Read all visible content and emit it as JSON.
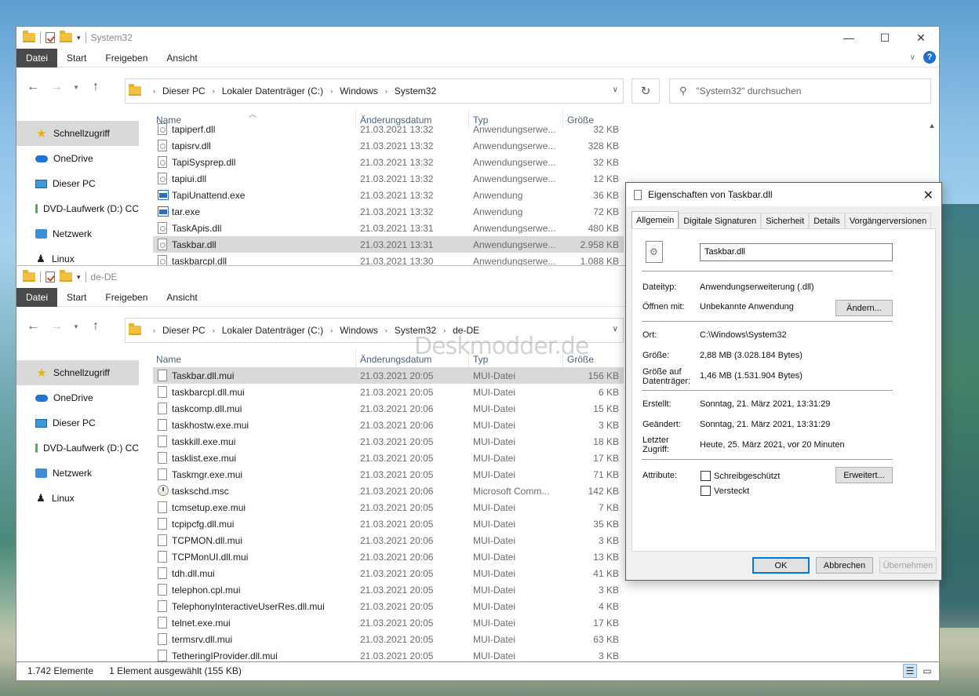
{
  "top_window": {
    "title": "System32",
    "ribbon_tabs": [
      "Datei",
      "Start",
      "Freigeben",
      "Ansicht"
    ],
    "breadcrumb": [
      "Dieser PC",
      "Lokaler Datenträger (C:)",
      "Windows",
      "System32"
    ],
    "search_placeholder": "\"System32\" durchsuchen",
    "columns": {
      "name": "Name",
      "date": "Änderungsdatum",
      "type": "Typ",
      "size": "Größe"
    },
    "files": [
      {
        "name": "tapiperf.dll",
        "date": "21.03.2021 13:32",
        "type": "Anwendungserwe...",
        "size": "32 KB",
        "icon": "dll"
      },
      {
        "name": "tapisrv.dll",
        "date": "21.03.2021 13:32",
        "type": "Anwendungserwe...",
        "size": "328 KB",
        "icon": "dll"
      },
      {
        "name": "TapiSysprep.dll",
        "date": "21.03.2021 13:32",
        "type": "Anwendungserwe...",
        "size": "32 KB",
        "icon": "dll"
      },
      {
        "name": "tapiui.dll",
        "date": "21.03.2021 13:32",
        "type": "Anwendungserwe...",
        "size": "12 KB",
        "icon": "dll"
      },
      {
        "name": "TapiUnattend.exe",
        "date": "21.03.2021 13:32",
        "type": "Anwendung",
        "size": "36 KB",
        "icon": "exe"
      },
      {
        "name": "tar.exe",
        "date": "21.03.2021 13:32",
        "type": "Anwendung",
        "size": "72 KB",
        "icon": "exe"
      },
      {
        "name": "TaskApis.dll",
        "date": "21.03.2021 13:31",
        "type": "Anwendungserwe...",
        "size": "480 KB",
        "icon": "dll"
      },
      {
        "name": "Taskbar.dll",
        "date": "21.03.2021 13:31",
        "type": "Anwendungserwe...",
        "size": "2.958 KB",
        "icon": "dll",
        "selected": true
      },
      {
        "name": "taskbarcpl.dll",
        "date": "21.03.2021 13:30",
        "type": "Anwendungserwe...",
        "size": "1.088 KB",
        "icon": "dll"
      }
    ],
    "status_count": "1.742 Elemente",
    "status_selected": "1 Element ausgewählt (155 KB)"
  },
  "bottom_window": {
    "title": "de-DE",
    "ribbon_tabs": [
      "Datei",
      "Start",
      "Freigeben",
      "Ansicht"
    ],
    "breadcrumb": [
      "Dieser PC",
      "Lokaler Datenträger (C:)",
      "Windows",
      "System32",
      "de-DE"
    ],
    "columns": {
      "name": "Name",
      "date": "Änderungsdatum",
      "type": "Typ",
      "size": "Größe"
    },
    "files": [
      {
        "name": "Taskbar.dll.mui",
        "date": "21.03.2021 20:05",
        "type": "MUI-Datei",
        "size": "156 KB",
        "icon": "mui",
        "selected": true
      },
      {
        "name": "taskbarcpl.dll.mui",
        "date": "21.03.2021 20:05",
        "type": "MUI-Datei",
        "size": "6 KB",
        "icon": "mui"
      },
      {
        "name": "taskcomp.dll.mui",
        "date": "21.03.2021 20:06",
        "type": "MUI-Datei",
        "size": "15 KB",
        "icon": "mui"
      },
      {
        "name": "taskhostw.exe.mui",
        "date": "21.03.2021 20:06",
        "type": "MUI-Datei",
        "size": "3 KB",
        "icon": "mui"
      },
      {
        "name": "taskkill.exe.mui",
        "date": "21.03.2021 20:05",
        "type": "MUI-Datei",
        "size": "18 KB",
        "icon": "mui"
      },
      {
        "name": "tasklist.exe.mui",
        "date": "21.03.2021 20:05",
        "type": "MUI-Datei",
        "size": "17 KB",
        "icon": "mui"
      },
      {
        "name": "Taskmgr.exe.mui",
        "date": "21.03.2021 20:05",
        "type": "MUI-Datei",
        "size": "71 KB",
        "icon": "mui"
      },
      {
        "name": "taskschd.msc",
        "date": "21.03.2021 20:06",
        "type": "Microsoft Comm...",
        "size": "142 KB",
        "icon": "msc"
      },
      {
        "name": "tcmsetup.exe.mui",
        "date": "21.03.2021 20:05",
        "type": "MUI-Datei",
        "size": "7 KB",
        "icon": "mui"
      },
      {
        "name": "tcpipcfg.dll.mui",
        "date": "21.03.2021 20:05",
        "type": "MUI-Datei",
        "size": "35 KB",
        "icon": "mui"
      },
      {
        "name": "TCPMON.dll.mui",
        "date": "21.03.2021 20:06",
        "type": "MUI-Datei",
        "size": "3 KB",
        "icon": "mui"
      },
      {
        "name": "TCPMonUI.dll.mui",
        "date": "21.03.2021 20:06",
        "type": "MUI-Datei",
        "size": "13 KB",
        "icon": "mui"
      },
      {
        "name": "tdh.dll.mui",
        "date": "21.03.2021 20:05",
        "type": "MUI-Datei",
        "size": "41 KB",
        "icon": "mui"
      },
      {
        "name": "telephon.cpl.mui",
        "date": "21.03.2021 20:05",
        "type": "MUI-Datei",
        "size": "3 KB",
        "icon": "mui"
      },
      {
        "name": "TelephonyInteractiveUserRes.dll.mui",
        "date": "21.03.2021 20:05",
        "type": "MUI-Datei",
        "size": "4 KB",
        "icon": "mui"
      },
      {
        "name": "telnet.exe.mui",
        "date": "21.03.2021 20:05",
        "type": "MUI-Datei",
        "size": "17 KB",
        "icon": "mui"
      },
      {
        "name": "termsrv.dll.mui",
        "date": "21.03.2021 20:05",
        "type": "MUI-Datei",
        "size": "63 KB",
        "icon": "mui"
      },
      {
        "name": "TetheringIProvider.dll.mui",
        "date": "21.03.2021 20:05",
        "type": "MUI-Datei",
        "size": "3 KB",
        "icon": "mui"
      }
    ]
  },
  "nav_items": [
    {
      "label": "Schnellzugriff",
      "icon": "star-icon"
    },
    {
      "label": "OneDrive",
      "icon": "cloud-icon"
    },
    {
      "label": "Dieser PC",
      "icon": "computer-icon"
    },
    {
      "label": "DVD-Laufwerk (D:) CC",
      "icon": "dvd-icon"
    },
    {
      "label": "Netzwerk",
      "icon": "network-icon"
    },
    {
      "label": "Linux",
      "icon": "linux-icon"
    }
  ],
  "watermark": "Deskmodder.de",
  "properties": {
    "title": "Eigenschaften von Taskbar.dll",
    "tabs": [
      "Allgemein",
      "Digitale Signaturen",
      "Sicherheit",
      "Details",
      "Vorgängerversionen"
    ],
    "filename": "Taskbar.dll",
    "dateityp_label": "Dateityp:",
    "dateityp": "Anwendungserweiterung (.dll)",
    "oeffnen_label": "Öffnen mit:",
    "oeffnen": "Unbekannte Anwendung",
    "aendern_button": "Ändern...",
    "ort_label": "Ort:",
    "ort": "C:\\Windows\\System32",
    "groesse_label": "Größe:",
    "groesse": "2,88 MB (3.028.184 Bytes)",
    "groesse_disk_label": "Größe auf Datenträger:",
    "groesse_disk": "1,46 MB (1.531.904 Bytes)",
    "erstellt_label": "Erstellt:",
    "erstellt": "Sonntag, 21. März 2021, 13:31:29",
    "geaendert_label": "Geändert:",
    "geaendert": "Sonntag, 21. März 2021, 13:31:29",
    "zugriff_label": "Letzter Zugriff:",
    "zugriff": "Heute, 25. März 2021, vor 20 Minuten",
    "attribute_label": "Attribute:",
    "schreibgeschuetzt": "Schreibgeschützt",
    "versteckt": "Versteckt",
    "erweitert_button": "Erweitert...",
    "ok_button": "OK",
    "abbrechen_button": "Abbrechen",
    "uebernehmen_button": "Übernehmen"
  }
}
